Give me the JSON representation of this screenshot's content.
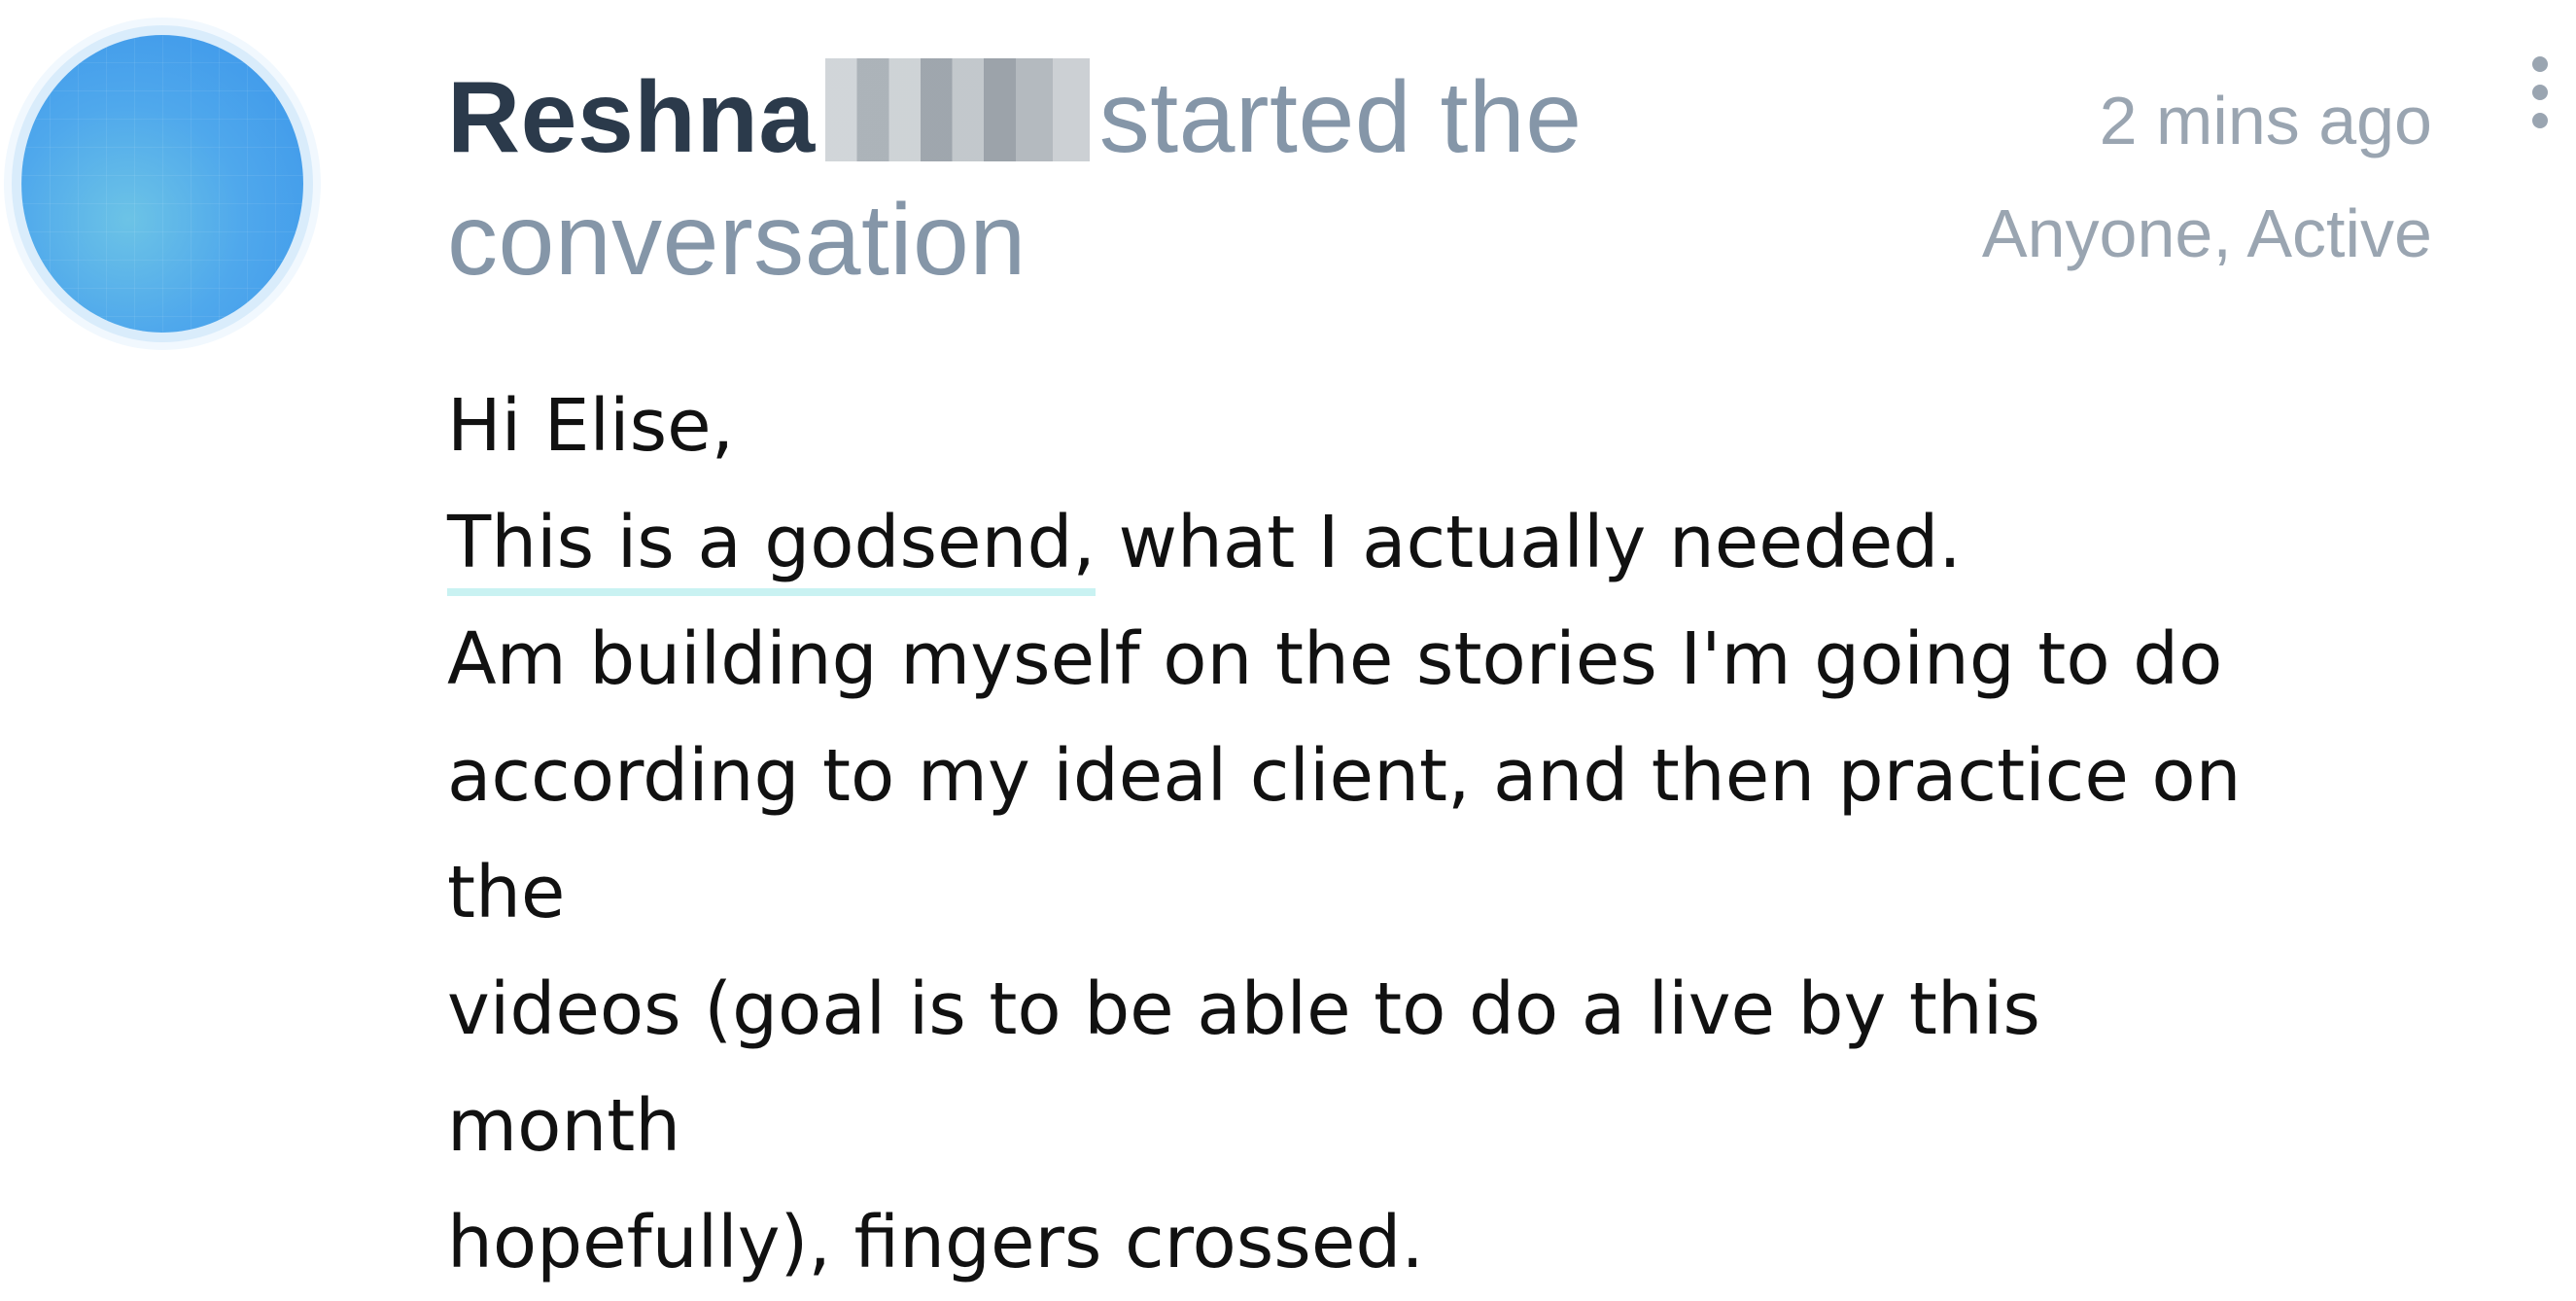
{
  "post": {
    "author_name": "Reshna",
    "action_text": "started the conversation",
    "timestamp": "2 mins ago",
    "visibility": "Anyone, Active",
    "avatar_color": "#4fa8ec",
    "more_icon": "vertical-ellipsis-icon",
    "body": {
      "greeting": "Hi Elise,",
      "highlight": "This is a godsend,",
      "line1_rest": " what I actually needed.",
      "line2": "Am building myself on the stories I'm going to do",
      "line3": "according to my ideal client, and then practice on the",
      "line4": "videos (goal is to be able to do a live by this month",
      "line5": "hopefully), fingers crossed."
    },
    "highlight_color": "#c9f2f2"
  }
}
